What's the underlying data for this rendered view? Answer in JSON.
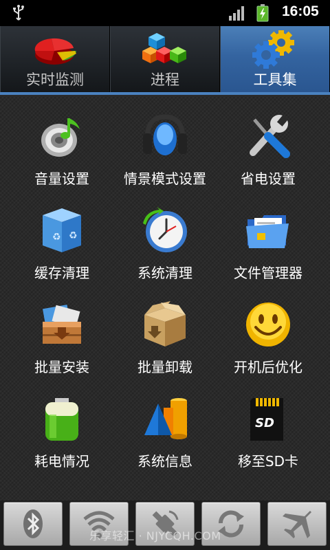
{
  "status_bar": {
    "time": "16:05",
    "icons": [
      "usb-icon",
      "signal-icon",
      "battery-charging-icon"
    ]
  },
  "tabs": [
    {
      "label": "实时监测",
      "icon": "pie-chart-icon",
      "active": false
    },
    {
      "label": "进程",
      "icon": "cubes-icon",
      "active": false
    },
    {
      "label": "工具集",
      "icon": "gears-icon",
      "active": true
    }
  ],
  "tools": [
    {
      "label": "音量设置",
      "icon": "speaker-music-icon"
    },
    {
      "label": "情景模式设置",
      "icon": "headphones-icon"
    },
    {
      "label": "省电设置",
      "icon": "wrench-screwdriver-icon"
    },
    {
      "label": "缓存清理",
      "icon": "recycle-box-icon"
    },
    {
      "label": "系统清理",
      "icon": "clock-icon"
    },
    {
      "label": "文件管理器",
      "icon": "folder-icon"
    },
    {
      "label": "批量安装",
      "icon": "install-box-icon"
    },
    {
      "label": "批量卸载",
      "icon": "open-box-icon"
    },
    {
      "label": "开机后优化",
      "icon": "smiley-icon"
    },
    {
      "label": "耗电情况",
      "icon": "battery-icon"
    },
    {
      "label": "系统信息",
      "icon": "shapes-icon"
    },
    {
      "label": "移至SD卡",
      "icon": "sd-card-icon"
    }
  ],
  "toggles": [
    {
      "icon": "bluetooth-icon"
    },
    {
      "icon": "wifi-icon"
    },
    {
      "icon": "gps-icon"
    },
    {
      "icon": "sync-icon"
    },
    {
      "icon": "airplane-icon"
    }
  ],
  "watermark": "乐享轻汇 · NJYCQH.COM"
}
